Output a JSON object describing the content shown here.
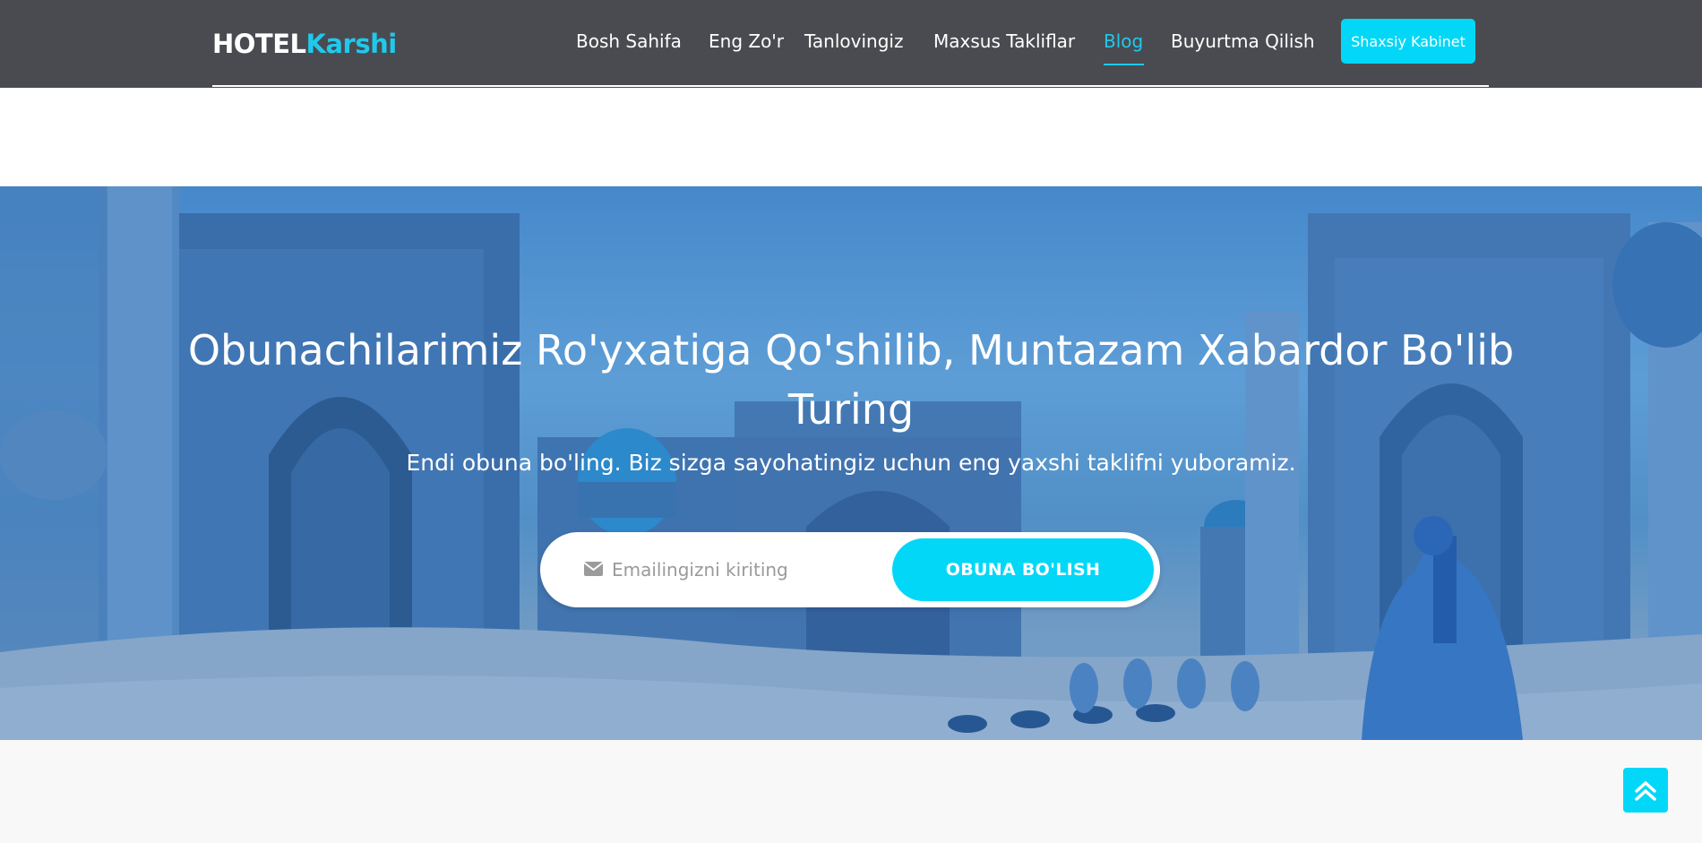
{
  "header": {
    "logo_part1": "HOTEL",
    "logo_part2": "Karshi",
    "nav": [
      {
        "label": "Bosh Sahifa"
      },
      {
        "label": "Eng Zo'r"
      },
      {
        "label": "Tanlovingiz"
      },
      {
        "label": "Maxsus Takliflar"
      },
      {
        "label": "Blog",
        "active": true
      },
      {
        "label": "Buyurtma Qilish"
      }
    ],
    "cabinet_button": "Shaxsiy Kabinet"
  },
  "hero": {
    "title": "Obunachilarimiz Ro'yxatiga Qo'shilib, Muntazam Xabardor Bo'lib Turing",
    "subtitle": "Endi obuna bo'ling. Biz sizga sayohatingiz uchun eng yaxshi taklifni yuboramiz.",
    "email_placeholder": "Emailingizni kiriting",
    "subscribe_button": "OBUNA BO'LISH",
    "mail_icon": "envelope-icon"
  },
  "scroll_top_icon": "double-chevron-up-icon",
  "colors": {
    "header_bg": "#4a4b50",
    "accent": "#1fc9ec",
    "button": "#03d7f7"
  }
}
